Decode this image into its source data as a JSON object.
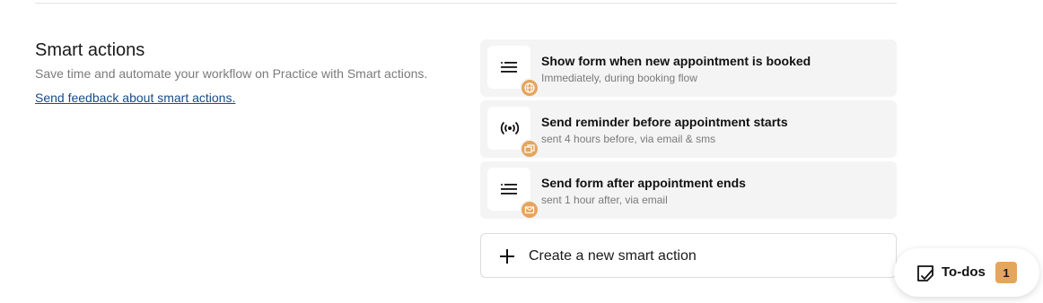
{
  "section": {
    "title": "Smart actions",
    "description": "Save time and automate your workflow on Practice with Smart actions.",
    "feedback_link": "Send feedback about smart actions."
  },
  "actions": [
    {
      "title": "Show form when new appointment is booked",
      "subtitle": "Immediately, during booking flow",
      "icon": "list-icon",
      "badge_icon": "globe-icon"
    },
    {
      "title": "Send reminder before appointment starts",
      "subtitle": "sent 4 hours before, via email & sms",
      "icon": "broadcast-icon",
      "badge_icon": "windows-icon"
    },
    {
      "title": "Send form after appointment ends",
      "subtitle": "sent 1 hour after, via email",
      "icon": "list-icon",
      "badge_icon": "mail-icon"
    }
  ],
  "create_button": {
    "label": "Create a new smart action",
    "icon": "plus-icon"
  },
  "todos": {
    "label": "To-dos",
    "count": "1",
    "icon": "note-check-icon"
  },
  "colors": {
    "accent": "#e4a55d",
    "link": "#1a4a8a",
    "card_bg": "#f4f4f4"
  }
}
